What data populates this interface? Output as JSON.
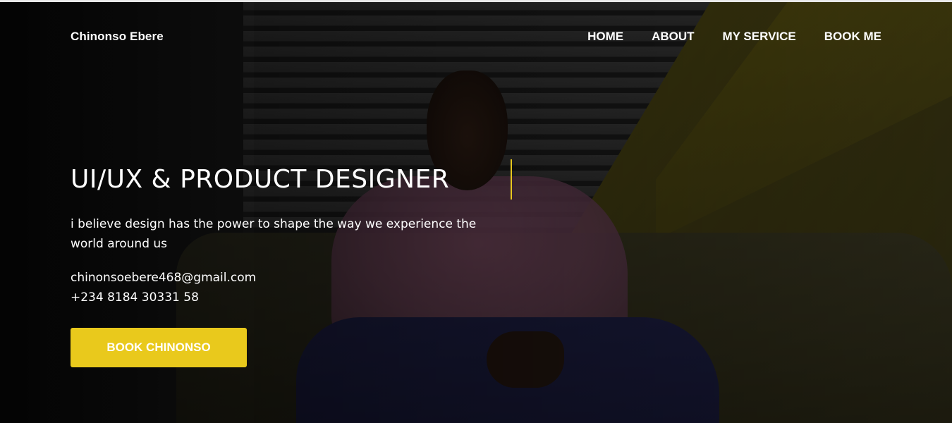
{
  "header": {
    "brand": "Chinonso Ebere",
    "nav": [
      {
        "label": "HOME"
      },
      {
        "label": "ABOUT"
      },
      {
        "label": "MY SERVICE"
      },
      {
        "label": "BOOK ME"
      }
    ]
  },
  "hero": {
    "headline": "UI/UX & PRODUCT DESIGNER",
    "tagline": "i believe design has the power to shape the way we experience the world around us",
    "email": "chinonsoebere468@gmail.com",
    "phone": "+234 8184 30331 58",
    "cta_label": "BOOK CHINONSO"
  },
  "colors": {
    "accent": "#e9c91c",
    "text": "#ffffff",
    "overlay": "#000000"
  }
}
